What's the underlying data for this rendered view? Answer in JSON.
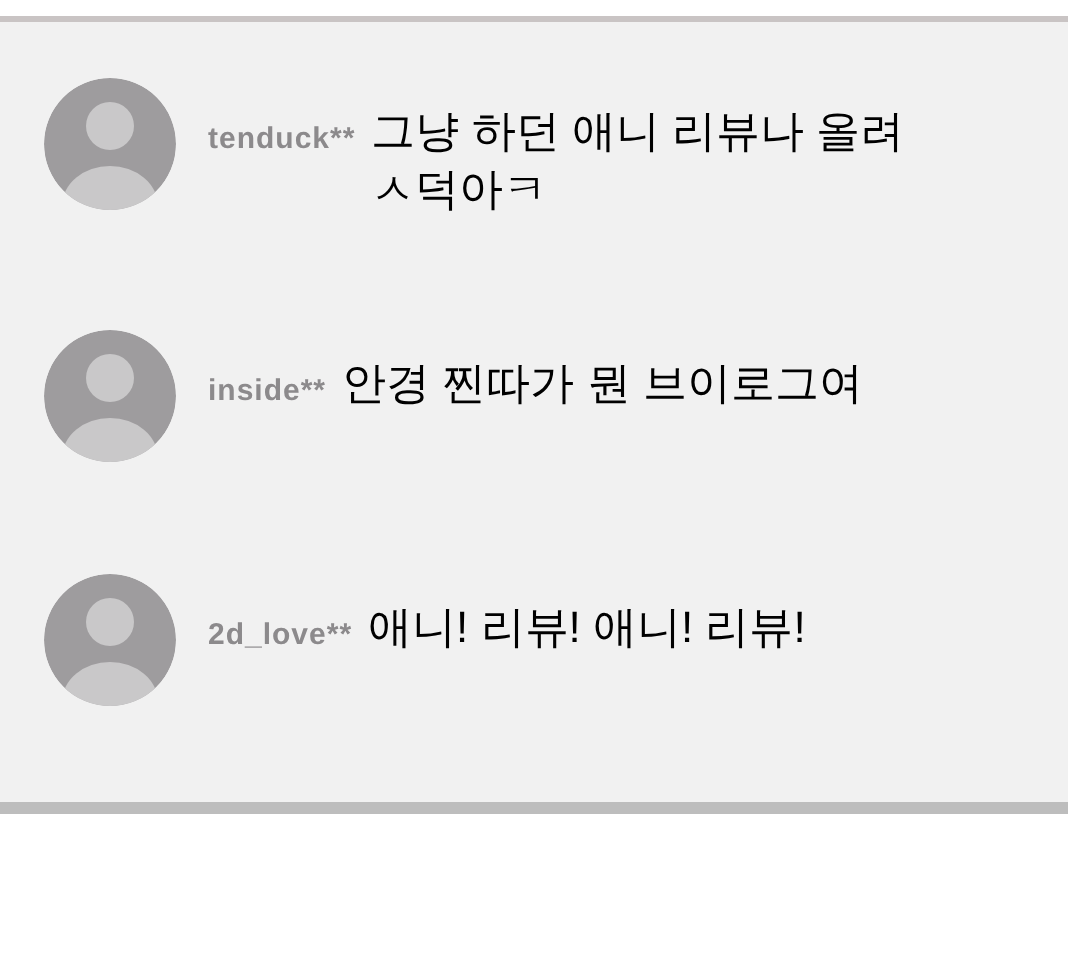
{
  "comments": [
    {
      "user": "tenduck**",
      "text": "그냥 하던 애니 리뷰나 올려 ㅅ덕아ㅋ"
    },
    {
      "user": "inside**",
      "text": "안경 찐따가 뭔 브이로그여"
    },
    {
      "user": "2d_love**",
      "text": "애니! 리뷰! 애니! 리뷰!"
    }
  ]
}
